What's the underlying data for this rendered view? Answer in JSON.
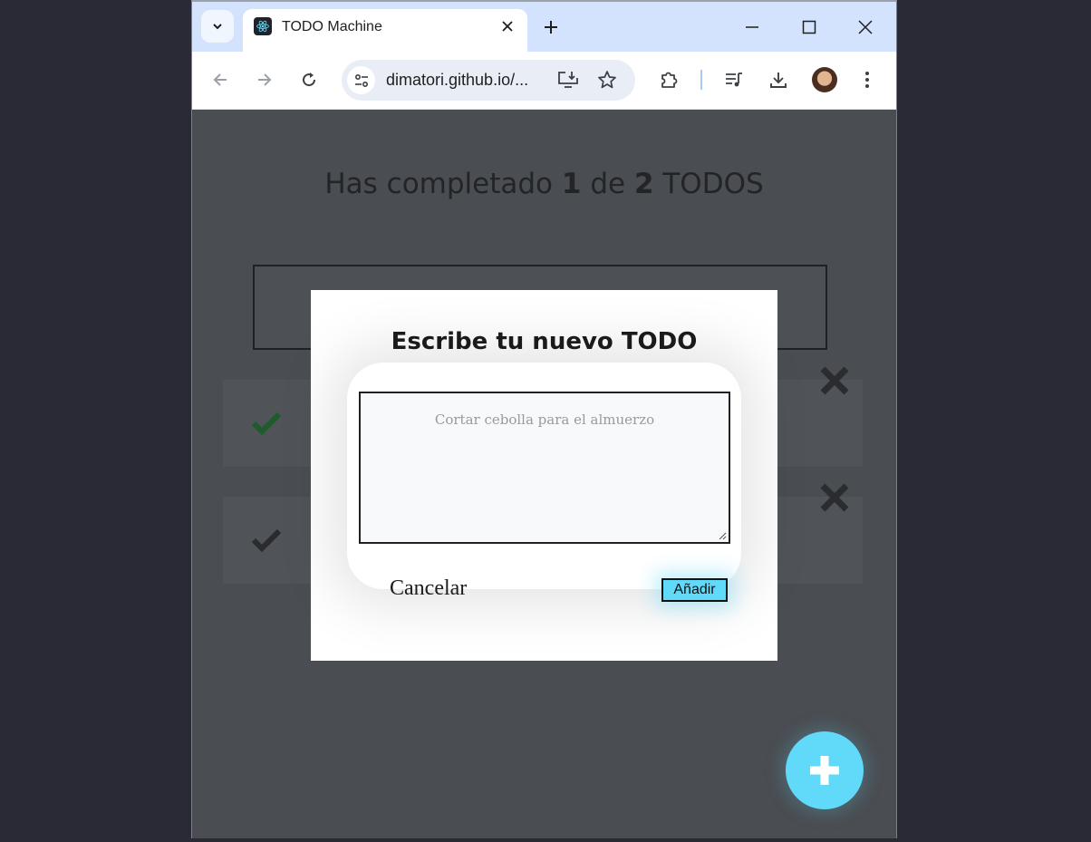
{
  "browser": {
    "tab_title": "TODO Machine",
    "url": "dimatori.github.io/...",
    "colors": {
      "titlebar": "#d3e3fd",
      "omnibox": "#e9eef6"
    }
  },
  "page": {
    "counter_prefix": "Has completado ",
    "completed": "1",
    "counter_middle": " de ",
    "total": "2",
    "counter_suffix": " TODOS",
    "todos": [
      {
        "completed": true,
        "check_color": "#1f5c2b"
      },
      {
        "completed": false,
        "check_color": "#2a2b2e"
      }
    ],
    "accent_color": "#61dafa"
  },
  "modal": {
    "title": "Escribe tu nuevo TODO",
    "textarea_placeholder": "Cortar cebolla para el almuerzo",
    "cancel_label": "Cancelar",
    "add_label": "Añadir"
  }
}
